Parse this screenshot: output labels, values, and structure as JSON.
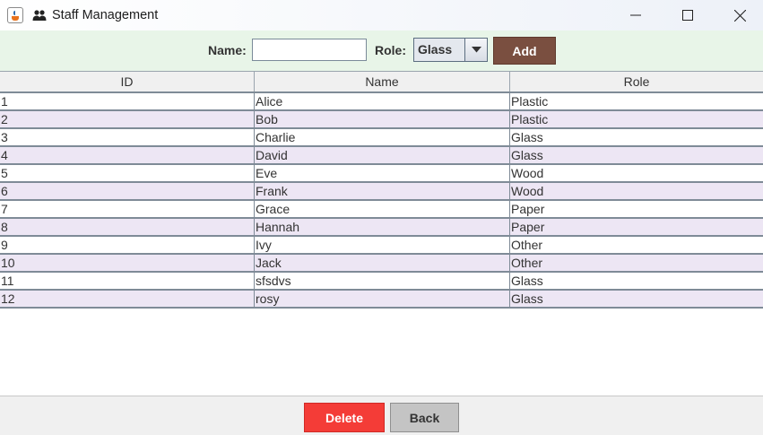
{
  "window": {
    "title": "Staff Management",
    "icons": {
      "app": "java-app-icon",
      "title": "people-icon"
    },
    "controls": [
      "minimize",
      "maximize",
      "close"
    ]
  },
  "form": {
    "name_label": "Name:",
    "name_value": "",
    "role_label": "Role:",
    "role_selected": "Glass",
    "add_label": "Add"
  },
  "table": {
    "columns": [
      "ID",
      "Name",
      "Role"
    ],
    "rows": [
      [
        "1",
        "Alice",
        "Plastic"
      ],
      [
        "2",
        "Bob",
        "Plastic"
      ],
      [
        "3",
        "Charlie",
        "Glass"
      ],
      [
        "4",
        "David",
        "Glass"
      ],
      [
        "5",
        "Eve",
        "Wood"
      ],
      [
        "6",
        "Frank",
        "Wood"
      ],
      [
        "7",
        "Grace",
        "Paper"
      ],
      [
        "8",
        "Hannah",
        "Paper"
      ],
      [
        "9",
        "Ivy",
        "Other"
      ],
      [
        "10",
        "Jack",
        "Other"
      ],
      [
        "11",
        "sfsdvs",
        "Glass"
      ],
      [
        "12",
        "rosy",
        "Glass"
      ]
    ]
  },
  "footer": {
    "delete_label": "Delete",
    "back_label": "Back"
  },
  "colors": {
    "form_bg": "#e8f5e8",
    "add_button": "#7a4f40",
    "delete_button": "#f43c37",
    "back_button": "#c4c4c4",
    "row_alt": "#ede6f4"
  }
}
